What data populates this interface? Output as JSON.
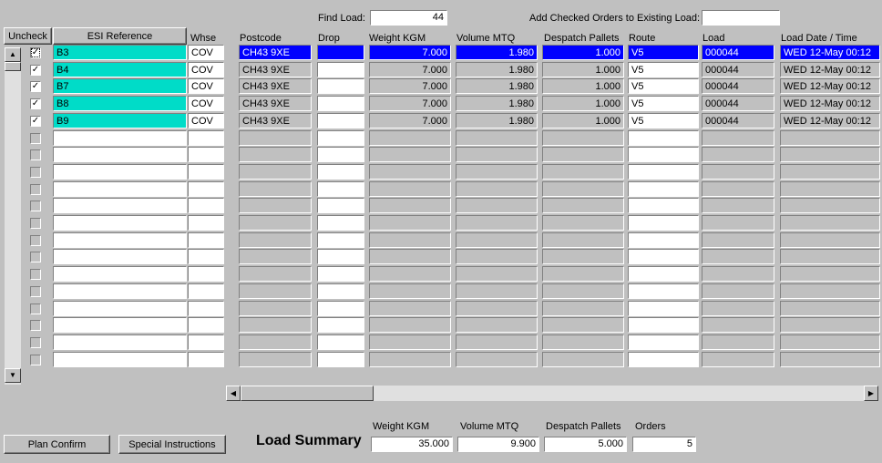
{
  "header": {
    "find_load_label": "Find Load:",
    "find_load_value": "44",
    "add_checked_label": "Add Checked Orders to Existing Load:",
    "add_checked_value": ""
  },
  "grid": {
    "uncheck_button": "Uncheck",
    "esi_button": "ESI Reference",
    "columns": {
      "whse": "Whse",
      "postcode": "Postcode",
      "drop": "Drop",
      "weight": "Weight KGM",
      "volume": "Volume MTQ",
      "pallets": "Despatch Pallets",
      "route": "Route",
      "load": "Load",
      "date": "Load Date / Time"
    },
    "rows": [
      {
        "checked": true,
        "esi": "B3",
        "whse": "COV",
        "postcode": "CH43 9XE",
        "drop": "",
        "weight": "7.000",
        "volume": "1.980",
        "pallets": "1.000",
        "route": "V5",
        "load": "000044",
        "date": "WED  12-May  00:12"
      },
      {
        "checked": true,
        "esi": "B4",
        "whse": "COV",
        "postcode": "CH43 9XE",
        "drop": "",
        "weight": "7.000",
        "volume": "1.980",
        "pallets": "1.000",
        "route": "V5",
        "load": "000044",
        "date": "WED  12-May  00:12"
      },
      {
        "checked": true,
        "esi": "B7",
        "whse": "COV",
        "postcode": "CH43 9XE",
        "drop": "",
        "weight": "7.000",
        "volume": "1.980",
        "pallets": "1.000",
        "route": "V5",
        "load": "000044",
        "date": "WED  12-May  00:12"
      },
      {
        "checked": true,
        "esi": "B8",
        "whse": "COV",
        "postcode": "CH43 9XE",
        "drop": "",
        "weight": "7.000",
        "volume": "1.980",
        "pallets": "1.000",
        "route": "V5",
        "load": "000044",
        "date": "WED  12-May  00:12"
      },
      {
        "checked": true,
        "esi": "B9",
        "whse": "COV",
        "postcode": "CH43 9XE",
        "drop": "",
        "weight": "7.000",
        "volume": "1.980",
        "pallets": "1.000",
        "route": "V5",
        "load": "000044",
        "date": "WED  12-May  00:12"
      }
    ],
    "empty_rows": 14,
    "icons": {
      "scroll_up": "arrow-up-icon",
      "scroll_down": "arrow-down-icon",
      "scroll_left": "arrow-left-icon",
      "scroll_right": "arrow-right-icon",
      "checkmark": "checkmark-icon"
    }
  },
  "footer": {
    "plan_confirm": "Plan Confirm",
    "special_instructions": "Special Instructions",
    "load_summary_title": "Load Summary",
    "weight_label": "Weight KGM",
    "weight_value": "35.000",
    "volume_label": "Volume MTQ",
    "volume_value": "9.900",
    "pallets_label": "Despatch Pallets",
    "pallets_value": "5.000",
    "orders_label": "Orders",
    "orders_value": "5"
  },
  "colors": {
    "teal": "#00dcc8",
    "selection": "#0000ff",
    "background": "#c0c0c0"
  }
}
